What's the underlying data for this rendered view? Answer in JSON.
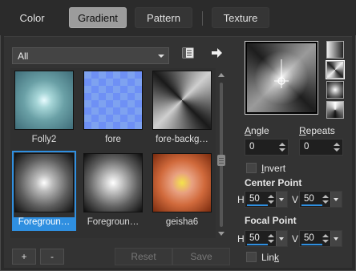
{
  "tabs": [
    {
      "label": "Color",
      "active": false
    },
    {
      "label": "Gradient",
      "active": true
    },
    {
      "label": "Pattern",
      "active": false
    },
    {
      "label": "Texture",
      "active": false
    }
  ],
  "category_select": {
    "value": "All"
  },
  "thumbnails": [
    {
      "label": "Folly2",
      "selected": false
    },
    {
      "label": "fore",
      "selected": false
    },
    {
      "label": "fore-backg…",
      "selected": false
    },
    {
      "label": "Foregroun…",
      "selected": true
    },
    {
      "label": "Foregroun…",
      "selected": false
    },
    {
      "label": "geisha6",
      "selected": false
    }
  ],
  "buttons": {
    "add": "+",
    "remove": "-",
    "reset": "Reset",
    "save": "Save"
  },
  "angle": {
    "label_prefix": "A",
    "label_rest": "ngle",
    "value": "0"
  },
  "repeats": {
    "label_prefix": "R",
    "label_rest": "epeats",
    "value": "0"
  },
  "invert": {
    "label_prefix": "I",
    "label_rest": "nvert",
    "checked": false
  },
  "center_point": {
    "title": "Center Point",
    "h_label": "H",
    "h": "50",
    "v_label": "V",
    "v": "50"
  },
  "focal_point": {
    "title": "Focal Point",
    "h_label": "H",
    "h": "50",
    "v_label": "V",
    "v": "50"
  },
  "link": {
    "label_a": "Lin",
    "label_u": "k",
    "checked": false
  },
  "colors": {
    "accent": "#2f8fe0",
    "panel": "#333333",
    "frame": "#2b2b2b"
  }
}
